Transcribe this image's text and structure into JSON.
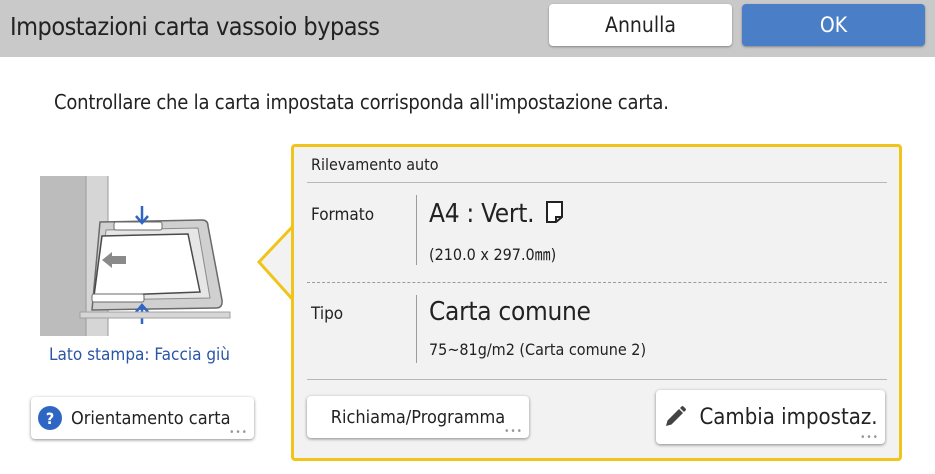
{
  "header": {
    "title": "Impostazioni carta vassoio bypass",
    "cancel_label": "Annulla",
    "ok_label": "OK"
  },
  "message": "Controllare che la carta impostata corrisponda all'impostazione carta.",
  "illustration": {
    "print_side": "Lato stampa: Faccia giù"
  },
  "orientation_button": {
    "label": "Orientamento carta",
    "icon": "help-icon"
  },
  "panel": {
    "auto_detect": "Rilevamento auto",
    "size": {
      "label": "Formato",
      "value": "A4 : Vert.",
      "detail": "(210.0 x 297.0㎜)"
    },
    "type": {
      "label": "Tipo",
      "value": "Carta comune",
      "detail": "75~81g/m2 (Carta comune 2)"
    },
    "recall_button": "Richiama/Programma",
    "change_button": "Cambia impostaz."
  },
  "colors": {
    "accent": "#4a7fc8",
    "highlight_border": "#f0c419",
    "titlebar": "#c9c9c9",
    "link_text": "#2a55a8"
  }
}
